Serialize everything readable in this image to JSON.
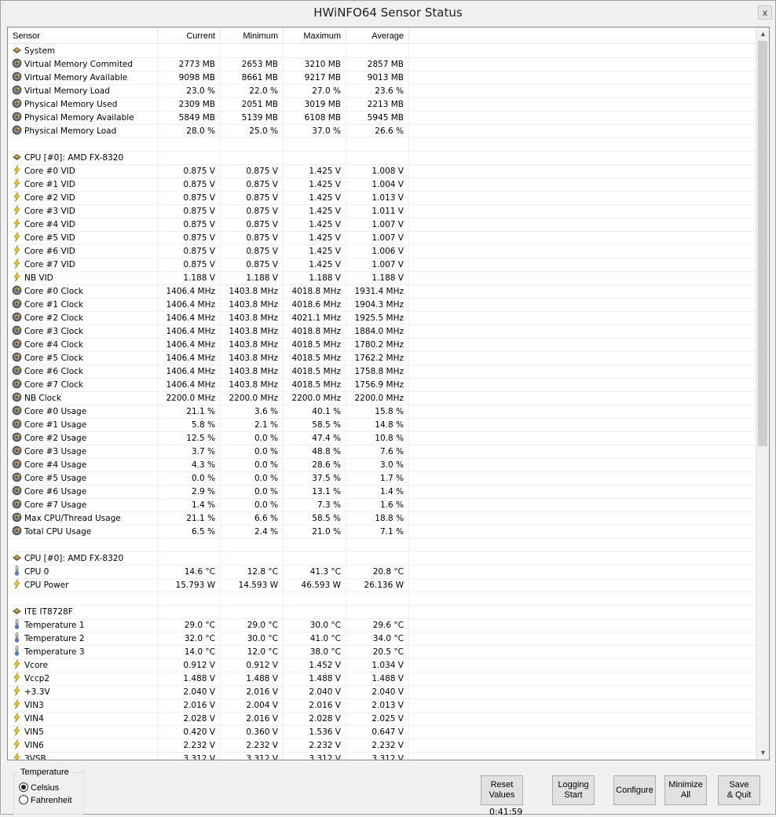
{
  "window": {
    "title": "HWiNFO64 Sensor Status",
    "close": "x"
  },
  "columns": [
    "Sensor",
    "Current",
    "Minimum",
    "Maximum",
    "Average"
  ],
  "rows": [
    {
      "t": "group",
      "icon": "chip",
      "name": "System"
    },
    {
      "t": "item",
      "icon": "gauge",
      "name": "Virtual Memory Commited",
      "v": [
        "2773 MB",
        "2653 MB",
        "3210 MB",
        "2857 MB"
      ]
    },
    {
      "t": "item",
      "icon": "gauge",
      "name": "Virtual Memory Available",
      "v": [
        "9098 MB",
        "8661 MB",
        "9217 MB",
        "9013 MB"
      ]
    },
    {
      "t": "item",
      "icon": "gauge",
      "name": "Virtual Memory Load",
      "v": [
        "23.0 %",
        "22.0 %",
        "27.0 %",
        "23.6 %"
      ]
    },
    {
      "t": "item",
      "icon": "gauge",
      "name": "Physical Memory Used",
      "v": [
        "2309 MB",
        "2051 MB",
        "3019 MB",
        "2213 MB"
      ]
    },
    {
      "t": "item",
      "icon": "gauge",
      "name": "Physical Memory Available",
      "v": [
        "5849 MB",
        "5139 MB",
        "6108 MB",
        "5945 MB"
      ]
    },
    {
      "t": "item",
      "icon": "gauge",
      "name": "Physical Memory Load",
      "v": [
        "28.0 %",
        "25.0 %",
        "37.0 %",
        "26.6 %"
      ]
    },
    {
      "t": "blank"
    },
    {
      "t": "group",
      "icon": "chip",
      "name": "CPU [#0]: AMD FX-8320"
    },
    {
      "t": "item",
      "icon": "bolt",
      "name": "Core #0 VID",
      "v": [
        "0.875 V",
        "0.875 V",
        "1.425 V",
        "1.008 V"
      ]
    },
    {
      "t": "item",
      "icon": "bolt",
      "name": "Core #1 VID",
      "v": [
        "0.875 V",
        "0.875 V",
        "1.425 V",
        "1.004 V"
      ]
    },
    {
      "t": "item",
      "icon": "bolt",
      "name": "Core #2 VID",
      "v": [
        "0.875 V",
        "0.875 V",
        "1.425 V",
        "1.013 V"
      ]
    },
    {
      "t": "item",
      "icon": "bolt",
      "name": "Core #3 VID",
      "v": [
        "0.875 V",
        "0.875 V",
        "1.425 V",
        "1.011 V"
      ]
    },
    {
      "t": "item",
      "icon": "bolt",
      "name": "Core #4 VID",
      "v": [
        "0.875 V",
        "0.875 V",
        "1.425 V",
        "1.007 V"
      ]
    },
    {
      "t": "item",
      "icon": "bolt",
      "name": "Core #5 VID",
      "v": [
        "0.875 V",
        "0.875 V",
        "1.425 V",
        "1.007 V"
      ]
    },
    {
      "t": "item",
      "icon": "bolt",
      "name": "Core #6 VID",
      "v": [
        "0.875 V",
        "0.875 V",
        "1.425 V",
        "1.006 V"
      ]
    },
    {
      "t": "item",
      "icon": "bolt",
      "name": "Core #7 VID",
      "v": [
        "0.875 V",
        "0.875 V",
        "1.425 V",
        "1.007 V"
      ]
    },
    {
      "t": "item",
      "icon": "bolt",
      "name": "NB VID",
      "v": [
        "1.188 V",
        "1.188 V",
        "1.188 V",
        "1.188 V"
      ]
    },
    {
      "t": "item",
      "icon": "gauge",
      "name": "Core #0 Clock",
      "v": [
        "1406.4 MHz",
        "1403.8 MHz",
        "4018.8 MHz",
        "1931.4 MHz"
      ]
    },
    {
      "t": "item",
      "icon": "gauge",
      "name": "Core #1 Clock",
      "v": [
        "1406.4 MHz",
        "1403.8 MHz",
        "4018.6 MHz",
        "1904.3 MHz"
      ]
    },
    {
      "t": "item",
      "icon": "gauge",
      "name": "Core #2 Clock",
      "v": [
        "1406.4 MHz",
        "1403.8 MHz",
        "4021.1 MHz",
        "1925.5 MHz"
      ]
    },
    {
      "t": "item",
      "icon": "gauge",
      "name": "Core #3 Clock",
      "v": [
        "1406.4 MHz",
        "1403.8 MHz",
        "4018.8 MHz",
        "1884.0 MHz"
      ]
    },
    {
      "t": "item",
      "icon": "gauge",
      "name": "Core #4 Clock",
      "v": [
        "1406.4 MHz",
        "1403.8 MHz",
        "4018.5 MHz",
        "1780.2 MHz"
      ]
    },
    {
      "t": "item",
      "icon": "gauge",
      "name": "Core #5 Clock",
      "v": [
        "1406.4 MHz",
        "1403.8 MHz",
        "4018.5 MHz",
        "1762.2 MHz"
      ]
    },
    {
      "t": "item",
      "icon": "gauge",
      "name": "Core #6 Clock",
      "v": [
        "1406.4 MHz",
        "1403.8 MHz",
        "4018.5 MHz",
        "1758.8 MHz"
      ]
    },
    {
      "t": "item",
      "icon": "gauge",
      "name": "Core #7 Clock",
      "v": [
        "1406.4 MHz",
        "1403.8 MHz",
        "4018.5 MHz",
        "1756.9 MHz"
      ]
    },
    {
      "t": "item",
      "icon": "gauge",
      "name": "NB Clock",
      "v": [
        "2200.0 MHz",
        "2200.0 MHz",
        "2200.0 MHz",
        "2200.0 MHz"
      ]
    },
    {
      "t": "item",
      "icon": "gauge",
      "name": "Core #0 Usage",
      "v": [
        "21.1 %",
        "3.6 %",
        "40.1 %",
        "15.8 %"
      ]
    },
    {
      "t": "item",
      "icon": "gauge",
      "name": "Core #1 Usage",
      "v": [
        "5.8 %",
        "2.1 %",
        "58.5 %",
        "14.8 %"
      ]
    },
    {
      "t": "item",
      "icon": "gauge",
      "name": "Core #2 Usage",
      "v": [
        "12.5 %",
        "0.0 %",
        "47.4 %",
        "10.8 %"
      ]
    },
    {
      "t": "item",
      "icon": "gauge",
      "name": "Core #3 Usage",
      "v": [
        "3.7 %",
        "0.0 %",
        "48.8 %",
        "7.6 %"
      ]
    },
    {
      "t": "item",
      "icon": "gauge",
      "name": "Core #4 Usage",
      "v": [
        "4.3 %",
        "0.0 %",
        "28.6 %",
        "3.0 %"
      ]
    },
    {
      "t": "item",
      "icon": "gauge",
      "name": "Core #5 Usage",
      "v": [
        "0.0 %",
        "0.0 %",
        "37.5 %",
        "1.7 %"
      ]
    },
    {
      "t": "item",
      "icon": "gauge",
      "name": "Core #6 Usage",
      "v": [
        "2.9 %",
        "0.0 %",
        "13.1 %",
        "1.4 %"
      ]
    },
    {
      "t": "item",
      "icon": "gauge",
      "name": "Core #7 Usage",
      "v": [
        "1.4 %",
        "0.0 %",
        "7.3 %",
        "1.6 %"
      ]
    },
    {
      "t": "item",
      "icon": "gauge",
      "name": "Max CPU/Thread Usage",
      "v": [
        "21.1 %",
        "6.6 %",
        "58.5 %",
        "18.8 %"
      ]
    },
    {
      "t": "item",
      "icon": "gauge",
      "name": "Total CPU Usage",
      "v": [
        "6.5 %",
        "2.4 %",
        "21.0 %",
        "7.1 %"
      ]
    },
    {
      "t": "blank"
    },
    {
      "t": "group",
      "icon": "chip",
      "name": "CPU [#0]: AMD FX-8320"
    },
    {
      "t": "item",
      "icon": "thermo",
      "name": "CPU 0",
      "v": [
        "14.6 °C",
        "12.8 °C",
        "41.3 °C",
        "20.8 °C"
      ]
    },
    {
      "t": "item",
      "icon": "bolt",
      "name": "CPU Power",
      "v": [
        "15.793 W",
        "14.593 W",
        "46.593 W",
        "26.136 W"
      ]
    },
    {
      "t": "blank"
    },
    {
      "t": "group",
      "icon": "chip",
      "name": "ITE IT8728F"
    },
    {
      "t": "item",
      "icon": "thermo",
      "name": "Temperature 1",
      "v": [
        "29.0 °C",
        "29.0 °C",
        "30.0 °C",
        "29.6 °C"
      ]
    },
    {
      "t": "item",
      "icon": "thermo",
      "name": "Temperature 2",
      "v": [
        "32.0 °C",
        "30.0 °C",
        "41.0 °C",
        "34.0 °C"
      ]
    },
    {
      "t": "item",
      "icon": "thermo",
      "name": "Temperature 3",
      "v": [
        "14.0 °C",
        "12.0 °C",
        "38.0 °C",
        "20.5 °C"
      ]
    },
    {
      "t": "item",
      "icon": "bolt",
      "name": "Vcore",
      "v": [
        "0.912 V",
        "0.912 V",
        "1.452 V",
        "1.034 V"
      ]
    },
    {
      "t": "item",
      "icon": "bolt",
      "name": "Vccp2",
      "v": [
        "1.488 V",
        "1.488 V",
        "1.488 V",
        "1.488 V"
      ]
    },
    {
      "t": "item",
      "icon": "bolt",
      "name": "+3.3V",
      "v": [
        "2.040 V",
        "2.016 V",
        "2.040 V",
        "2.040 V"
      ]
    },
    {
      "t": "item",
      "icon": "bolt",
      "name": "VIN3",
      "v": [
        "2.016 V",
        "2.004 V",
        "2.016 V",
        "2.013 V"
      ]
    },
    {
      "t": "item",
      "icon": "bolt",
      "name": "VIN4",
      "v": [
        "2.028 V",
        "2.016 V",
        "2.028 V",
        "2.025 V"
      ]
    },
    {
      "t": "item",
      "icon": "bolt",
      "name": "VIN5",
      "v": [
        "0.420 V",
        "0.360 V",
        "1.536 V",
        "0.647 V"
      ]
    },
    {
      "t": "item",
      "icon": "bolt",
      "name": "VIN6",
      "v": [
        "2.232 V",
        "2.232 V",
        "2.232 V",
        "2.232 V"
      ]
    },
    {
      "t": "item",
      "icon": "bolt",
      "name": "3VSB",
      "v": [
        "3.312 V",
        "3.312 V",
        "3.312 V",
        "3.312 V"
      ]
    }
  ],
  "temperature": {
    "label": "Temperature",
    "celsius": "Celsius",
    "fahrenheit": "Fahrenheit",
    "selected": "celsius"
  },
  "buttons": {
    "reset": "Reset\nValues",
    "logging": "Logging\nStart",
    "configure": "Configure",
    "minimize": "Minimize\nAll",
    "save": "Save\n& Quit"
  },
  "timer": "0:41:59"
}
